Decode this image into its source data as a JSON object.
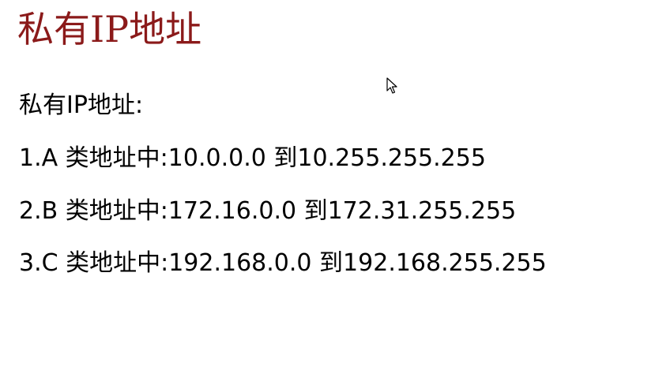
{
  "slide": {
    "title": "私有IP地址",
    "body": [
      "私有IP地址:",
      "1.A 类地址中:10.0.0.0 到10.255.255.255",
      "2.B 类地址中:172.16.0.0 到172.31.255.255",
      "3.C 类地址中:192.168.0.0 到192.168.255.255"
    ]
  },
  "cursor": {
    "icon": "mouse-pointer-icon"
  }
}
